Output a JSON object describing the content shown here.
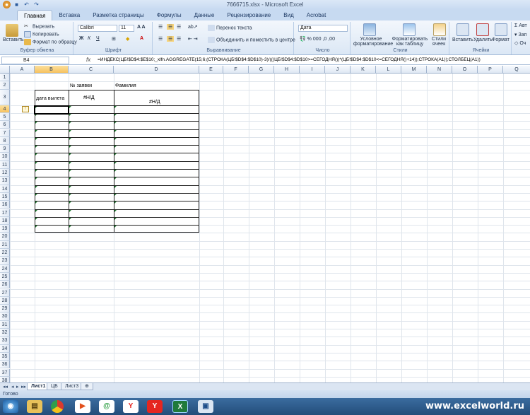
{
  "window": {
    "title": "7666715.xlsx - Microsoft Excel"
  },
  "ribbon_tabs": [
    "Главная",
    "Вставка",
    "Разметка страницы",
    "Формулы",
    "Данные",
    "Рецензирование",
    "Вид",
    "Acrobat"
  ],
  "clipboard": {
    "paste": "Вставить",
    "cut": "Вырезать",
    "copy": "Копировать",
    "format_painter": "Формат по образцу",
    "label": "Буфер обмена"
  },
  "font": {
    "name": "Calibri",
    "size": "11",
    "label": "Шрифт"
  },
  "alignment": {
    "wrap": "Перенос текста",
    "merge": "Объединить и поместить в центре",
    "label": "Выравнивание"
  },
  "number": {
    "format": "Дата",
    "label": "Число"
  },
  "styles": {
    "conditional": "Условное форматирование",
    "as_table": "Форматировать как таблицу",
    "cell_styles": "Стили ячеек",
    "label": "Стили"
  },
  "cells": {
    "insert": "Вставить",
    "delete": "Удалить",
    "format": "Формат",
    "label": "Ячейки"
  },
  "editing": {
    "autosum": "Авт",
    "fill": "Зап",
    "clear": "Оч"
  },
  "formula_bar": {
    "name_box": "B4",
    "fx": "fx",
    "formula": "=ИНДЕКС(ЦБ!$D$4:$E$10;_xlfn.AGGREGATE(15;6;(СТРОКА(ЦБ!$D$4:$D$10)-3)/(((ЦБ!$D$4:$D$10>=СЕГОДНЯ())*(ЦБ!$D$4:$D$10<=СЕГОДНЯ()+14));СТРОКА(A1));СТОЛБЕЦ(A1))"
  },
  "columns": [
    "A",
    "B",
    "C",
    "D",
    "E",
    "F",
    "G",
    "H",
    "I",
    "J",
    "K",
    "L",
    "M",
    "N",
    "O",
    "P",
    "Q"
  ],
  "rows": [
    "1",
    "2",
    "3",
    "4",
    "5",
    "6",
    "7",
    "8",
    "9",
    "10",
    "11",
    "12",
    "13",
    "14",
    "15",
    "16",
    "17",
    "18",
    "19",
    "20",
    "21",
    "22",
    "23",
    "24",
    "25",
    "26",
    "27",
    "28",
    "29",
    "30",
    "31",
    "32",
    "33",
    "34",
    "35",
    "36",
    "37",
    "38"
  ],
  "cells_content": {
    "c2": "№ заявки",
    "d2": "Фамилия",
    "b3": "дата вылета",
    "c3": "#Н/Д",
    "d3": "#Н/Д"
  },
  "sheets": [
    "Лист1",
    "ЦБ",
    "Лист3"
  ],
  "status": "Готово",
  "watermark": "www.excelworld.ru"
}
